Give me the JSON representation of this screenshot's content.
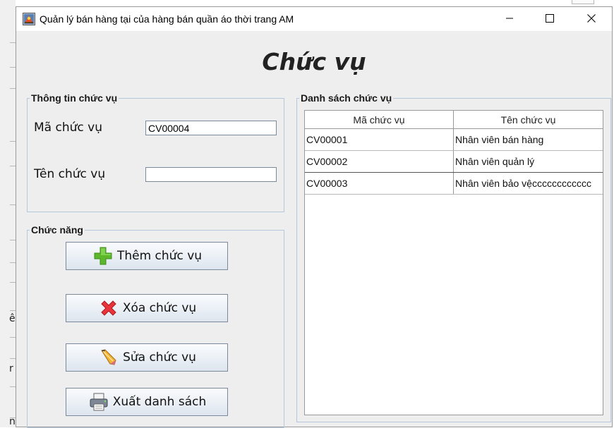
{
  "window": {
    "title": "Quản lý bán hàng tại của hàng bán quần áo thời trang AM",
    "controls": {
      "minimize": "—",
      "maximize": "☐",
      "close": "✕"
    }
  },
  "page_title": "Chức vụ",
  "info_group": {
    "label": "Thông tin chức vụ",
    "code_label": "Mã chức vụ",
    "code_value": "CV00004",
    "name_label": "Tên chức vụ",
    "name_value": ""
  },
  "function_group": {
    "label": "Chức năng",
    "buttons": [
      {
        "label": "Thêm chức vụ",
        "icon": "plus-icon"
      },
      {
        "label": "Xóa chức vụ",
        "icon": "delete-x-icon"
      },
      {
        "label": "Sửa chức vụ",
        "icon": "pencil-icon"
      },
      {
        "label": "Xuất danh sách",
        "icon": "printer-icon"
      }
    ]
  },
  "list_group": {
    "label": "Danh sách chức vụ",
    "columns": [
      "Mã chức vụ",
      "Tên chức vụ"
    ],
    "rows": [
      [
        "CV00001",
        "Nhân viên bán hàng"
      ],
      [
        "CV00002",
        "Nhân viên quản lý"
      ],
      [
        "CV00003",
        "Nhân viên bảo vệcccccccccccc"
      ]
    ]
  },
  "background": {
    "partial_letters": [
      "ê",
      "r",
      "n"
    ]
  },
  "colors": {
    "window_bg": "#eeeeee",
    "group_border": "#b5c7dc",
    "plus_green": "#5cb82a",
    "delete_red": "#e8343a"
  }
}
